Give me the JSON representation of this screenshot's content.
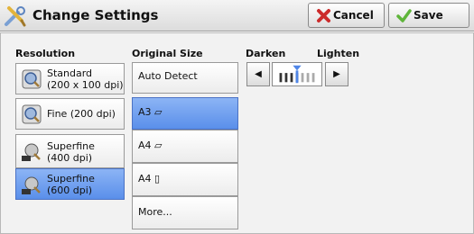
{
  "header": {
    "title": "Change Settings",
    "cancel_label": "Cancel",
    "save_label": "Save"
  },
  "resolution": {
    "title": "Resolution",
    "options": [
      {
        "line1": "Standard",
        "line2": "(200 x 100 dpi)",
        "icon": "standard-resolution-icon"
      },
      {
        "line1": "Fine (200 dpi)",
        "line2": "",
        "icon": "fine-resolution-icon"
      },
      {
        "line1": "Superfine",
        "line2": "(400 dpi)",
        "icon": "superfine-400-icon"
      },
      {
        "line1": "Superfine",
        "line2": "(600 dpi)",
        "icon": "superfine-600-icon"
      }
    ],
    "selected_index": 3
  },
  "original_size": {
    "title": "Original Size",
    "options": [
      "Auto Detect",
      "A3 ▱",
      "A4 ▱",
      "A4 ▯",
      "More..."
    ],
    "selected_index": 1
  },
  "density": {
    "darken_label": "Darken",
    "lighten_label": "Lighten",
    "left_arrow": "◀",
    "right_arrow": "▶",
    "steps": 7,
    "current_step": 3
  },
  "colors": {
    "selected_fill": "#5a8fea",
    "cancel_icon": "#cc2b2b",
    "save_icon": "#5fb53a"
  }
}
